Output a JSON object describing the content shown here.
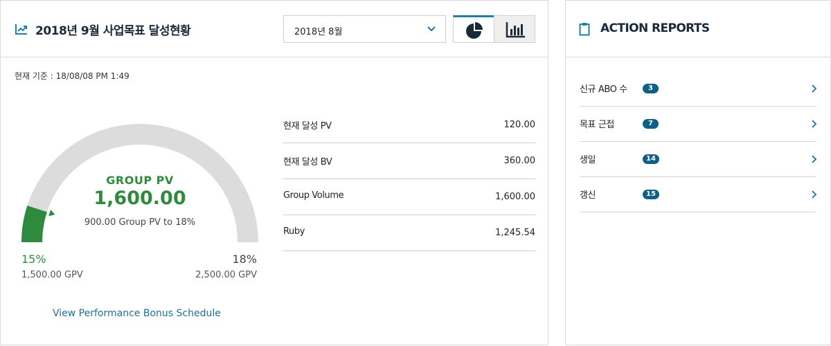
{
  "left_panel": {
    "title": "2018년 9월 사업목표 달성현황",
    "month_select": {
      "selected": "2018년 8월"
    },
    "view_toggle": {
      "active": "pie"
    },
    "timestamp": "현재 기준 : 18/08/08 PM 1:49",
    "gauge": {
      "label": "GROUP PV",
      "value": "1,600.00",
      "subtext": "900.00 Group PV to 18%",
      "min_pct": "15%",
      "min_gpv": "1,500.00 GPV",
      "max_pct": "18%",
      "max_gpv": "2,500.00 GPV",
      "progress": 0.1,
      "fill_color": "#2e8b3d",
      "track_color": "#dcdcdc"
    },
    "stats": [
      {
        "label": "현재 달성 PV",
        "value": "120.00"
      },
      {
        "label": "현재 달성 BV",
        "value": "360.00"
      },
      {
        "label": "Group Volume",
        "value": "1,600.00"
      },
      {
        "label": "Ruby",
        "value": "1,245.54"
      }
    ],
    "bonus_link": "View Performance Bonus Schedule"
  },
  "right_panel": {
    "title": "ACTION REPORTS",
    "items": [
      {
        "label": "신규 ABO 수",
        "count": "3"
      },
      {
        "label": "목표 근접",
        "count": "7"
      },
      {
        "label": "생일",
        "count": "14"
      },
      {
        "label": "갱신",
        "count": "15"
      }
    ]
  },
  "colors": {
    "accent": "#1f7fa7",
    "badge": "#0f5f87",
    "success": "#2e8b3d"
  },
  "icons": {
    "title": "trending-up-icon",
    "select": "chevron-down-icon",
    "pie_view": "pie-chart-icon",
    "bar_view": "bar-chart-icon",
    "action_reports": "clipboard-icon",
    "item_arrow": "chevron-right-icon"
  }
}
